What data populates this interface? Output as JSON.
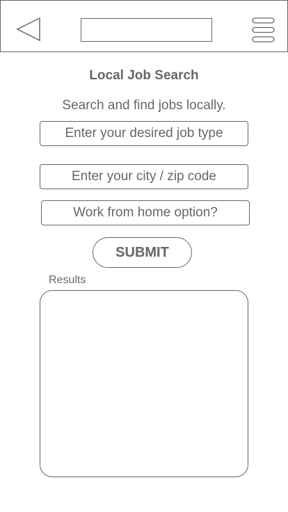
{
  "header": {
    "back_icon": "back-triangle-icon",
    "title_value": "",
    "menu_icon": "hamburger-menu-icon"
  },
  "main": {
    "title": "Local Job Search",
    "subtitle": "Search and find jobs locally.",
    "fields": {
      "job_type_placeholder": "Enter your desired job type",
      "city_zip_placeholder": "Enter your city / zip code",
      "wfh_placeholder": "Work from home option?"
    },
    "submit_label": "SUBMIT",
    "results_label": "Results"
  },
  "colors": {
    "stroke": "#666666",
    "text": "#666666",
    "background": "#ffffff"
  }
}
